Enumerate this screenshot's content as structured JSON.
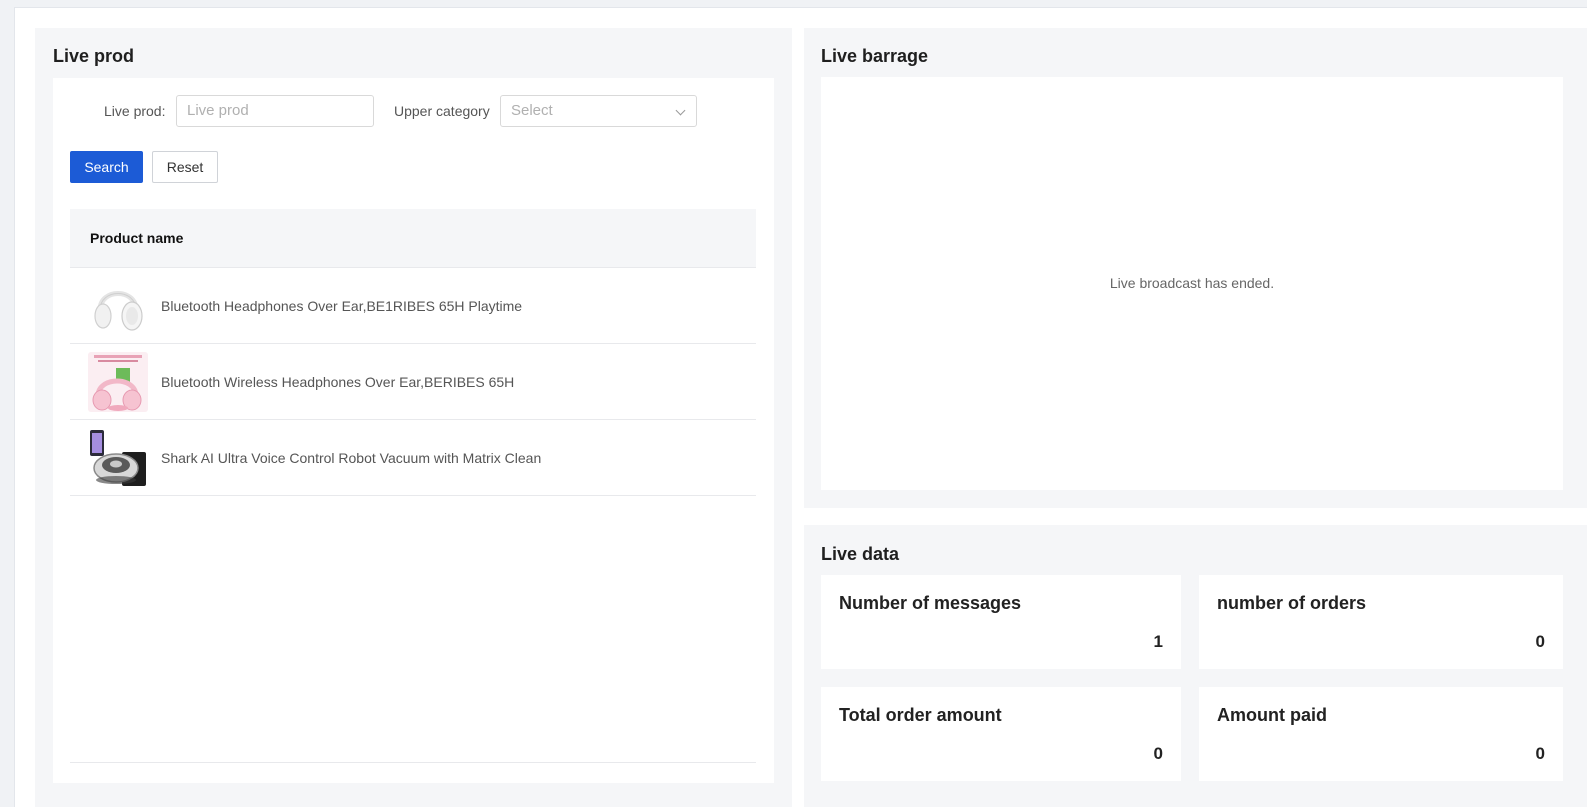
{
  "live_prod": {
    "title": "Live prod",
    "filter": {
      "prod_label": "Live prod:",
      "prod_placeholder": "Live prod",
      "category_label": "Upper category",
      "category_value": "Select"
    },
    "search_label": "Search",
    "reset_label": "Reset",
    "table": {
      "header": "Product name",
      "rows": [
        {
          "name": "Bluetooth Headphones Over Ear,BE1RIBES 65H Playtime",
          "thumb": "white-headphones"
        },
        {
          "name": "Bluetooth Wireless Headphones Over Ear,BERIBES 65H",
          "thumb": "pink-headphones"
        },
        {
          "name": "Shark AI Ultra Voice Control Robot Vacuum with Matrix Clean",
          "thumb": "robot-vacuum"
        }
      ]
    }
  },
  "live_barrage": {
    "title": "Live barrage",
    "message": "Live broadcast has ended."
  },
  "live_data": {
    "title": "Live data",
    "cards": [
      {
        "label": "Number of messages",
        "value": "1"
      },
      {
        "label": "number of orders",
        "value": "0"
      },
      {
        "label": "Total order amount",
        "value": "0"
      },
      {
        "label": "Amount paid",
        "value": "0"
      }
    ]
  },
  "colors": {
    "primary": "#1c5bd6",
    "panel_bg": "#f5f6f8"
  }
}
